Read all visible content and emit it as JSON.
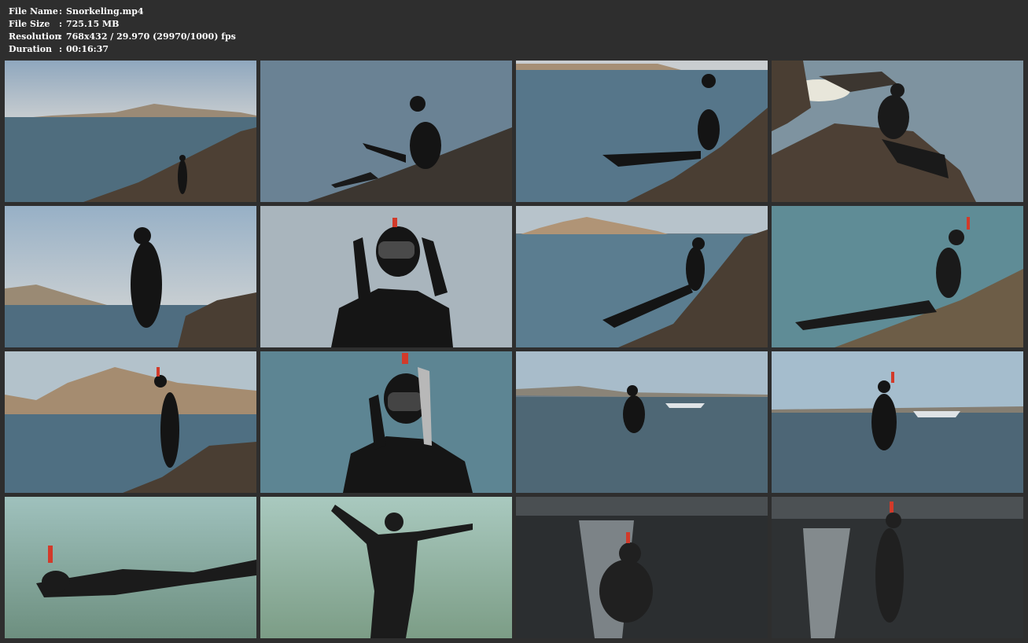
{
  "info": {
    "file_name_label": "File Name",
    "file_name": "Snorkeling.mp4",
    "file_size_label": "File Size",
    "file_size": "725.15 MB",
    "resolution_label": "Resolution",
    "resolution": "768x432 / 29.970 (29970/1000) fps",
    "duration_label": "Duration",
    "duration": "00:16:37",
    "separator": ":"
  },
  "colors": {
    "background": "#2e2e2e",
    "text": "#ffffff"
  },
  "thumbnails": [
    {
      "scene": "standing-on-rocks-far"
    },
    {
      "scene": "sitting-on-rock-fins"
    },
    {
      "scene": "sitting-on-rock-profile"
    },
    {
      "scene": "sitting-rocks-sun-glare"
    },
    {
      "scene": "standing-portrait-shore"
    },
    {
      "scene": "closeup-adjusting-mask"
    },
    {
      "scene": "reclining-rock-mountain"
    },
    {
      "scene": "reclining-rock-water"
    },
    {
      "scene": "standing-snorkel-mountain"
    },
    {
      "scene": "closeup-mask-snorkel-sea"
    },
    {
      "scene": "wading-boat-background"
    },
    {
      "scene": "wading-snorkel-boat"
    },
    {
      "scene": "floating-facedown-shallows"
    },
    {
      "scene": "floating-back-arms-spread"
    },
    {
      "scene": "wading-sun-glare-backlit"
    },
    {
      "scene": "standing-sun-glare-backlit"
    }
  ]
}
